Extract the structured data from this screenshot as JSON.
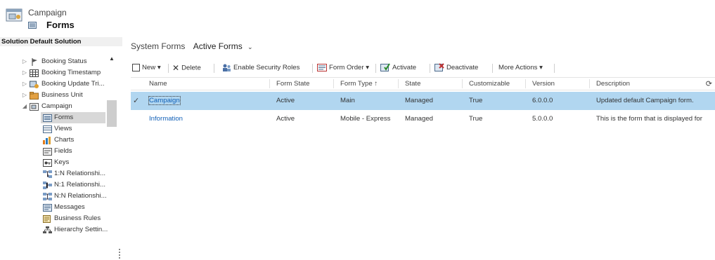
{
  "header": {
    "entity_name": "Campaign",
    "component_title": "Forms"
  },
  "sidebar": {
    "title": "Solution Default Solution",
    "items": [
      {
        "label": "Booking Status",
        "expander": "▷",
        "icon": "flag-icon"
      },
      {
        "label": "Booking Timestamp",
        "expander": "▷",
        "icon": "grid-icon"
      },
      {
        "label": "Booking Update Tri...",
        "expander": "▷",
        "icon": "entity-icon"
      },
      {
        "label": "Business Unit",
        "expander": "▷",
        "icon": "folder-icon"
      },
      {
        "label": "Campaign",
        "expander": "◢",
        "icon": "entity-icon"
      },
      {
        "label": "Forms",
        "icon": "form-icon"
      },
      {
        "label": "Views",
        "icon": "view-icon"
      },
      {
        "label": "Charts",
        "icon": "chart-icon"
      },
      {
        "label": "Fields",
        "icon": "field-icon"
      },
      {
        "label": "Keys",
        "icon": "key-icon"
      },
      {
        "label": "1:N Relationshi...",
        "icon": "relationship-icon"
      },
      {
        "label": "N:1 Relationshi...",
        "icon": "relationship-icon"
      },
      {
        "label": "N:N Relationshi...",
        "icon": "relationship-icon"
      },
      {
        "label": "Messages",
        "icon": "message-icon"
      },
      {
        "label": "Business Rules",
        "icon": "rule-icon"
      },
      {
        "label": "Hierarchy Settin...",
        "icon": "hierarchy-icon"
      }
    ]
  },
  "view_selector": {
    "system_label": "System Forms",
    "current_view": "Active Forms",
    "chevron": "⌄"
  },
  "toolbar": {
    "new_label": "New",
    "delete_label": "Delete",
    "security_roles_label": "Enable Security Roles",
    "form_order_label": "Form Order",
    "activate_label": "Activate",
    "deactivate_label": "Deactivate",
    "more_actions_label": "More Actions",
    "dropdown_glyph": "▾"
  },
  "grid": {
    "columns": [
      "Name",
      "Form State",
      "Form Type",
      "State",
      "Customizable",
      "Version",
      "Description"
    ],
    "sort_indicator": "↑",
    "refresh_glyph": "⟳",
    "check_glyph": "✓",
    "rows": [
      {
        "name": "Campaign",
        "form_state": "Active",
        "form_type": "Main",
        "state": "Managed",
        "customizable": "True",
        "version": "6.0.0.0",
        "description": "Updated default Campaign form.",
        "selected": true
      },
      {
        "name": "Information",
        "form_state": "Active",
        "form_type": "Mobile - Express",
        "state": "Managed",
        "customizable": "True",
        "version": "5.0.0.0",
        "description": "This is the form that is displayed for",
        "selected": false
      }
    ]
  },
  "colors": {
    "selected_row": "#b1d6f0",
    "link": "#1160b7",
    "sidebar_selected": "#d8d8d8"
  }
}
